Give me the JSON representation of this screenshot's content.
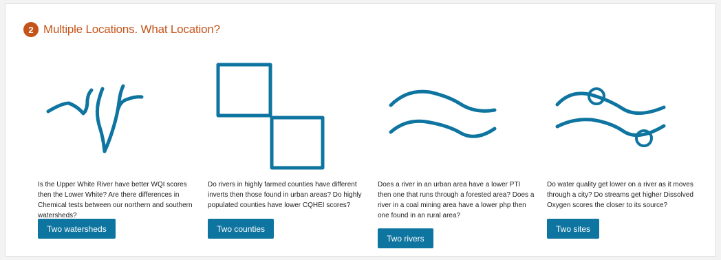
{
  "section": {
    "step": "2",
    "title": "Multiple Locations. What Location?"
  },
  "cards": [
    {
      "icon": "river-branches-icon",
      "question": "Is the Upper White River have better WQI scores then the Lower White? Are there differences in Chemical tests between our northern and southern watersheds?",
      "button": "Two watersheds"
    },
    {
      "icon": "two-squares-icon",
      "question": "Do rivers in highly farmed counties have different inverts then those found in urban areas? Do highly populated counties have lower CQHEI scores?",
      "button": "Two counties"
    },
    {
      "icon": "two-waves-icon",
      "question": "Does a river in an urban area have a lower PTI then one that runs through a forested area? Does a river in a coal mining area have a lower php then one found in an rural area?",
      "button": "Two rivers"
    },
    {
      "icon": "waves-with-sites-icon",
      "question": "Do water quality get lower on a river as it moves through a city? Do streams get higher Dissolved Oxygen scores the closer to its source?",
      "button": "Two sites"
    }
  ],
  "colors": {
    "accent": "#c5541a",
    "primary": "#0e74a0"
  }
}
